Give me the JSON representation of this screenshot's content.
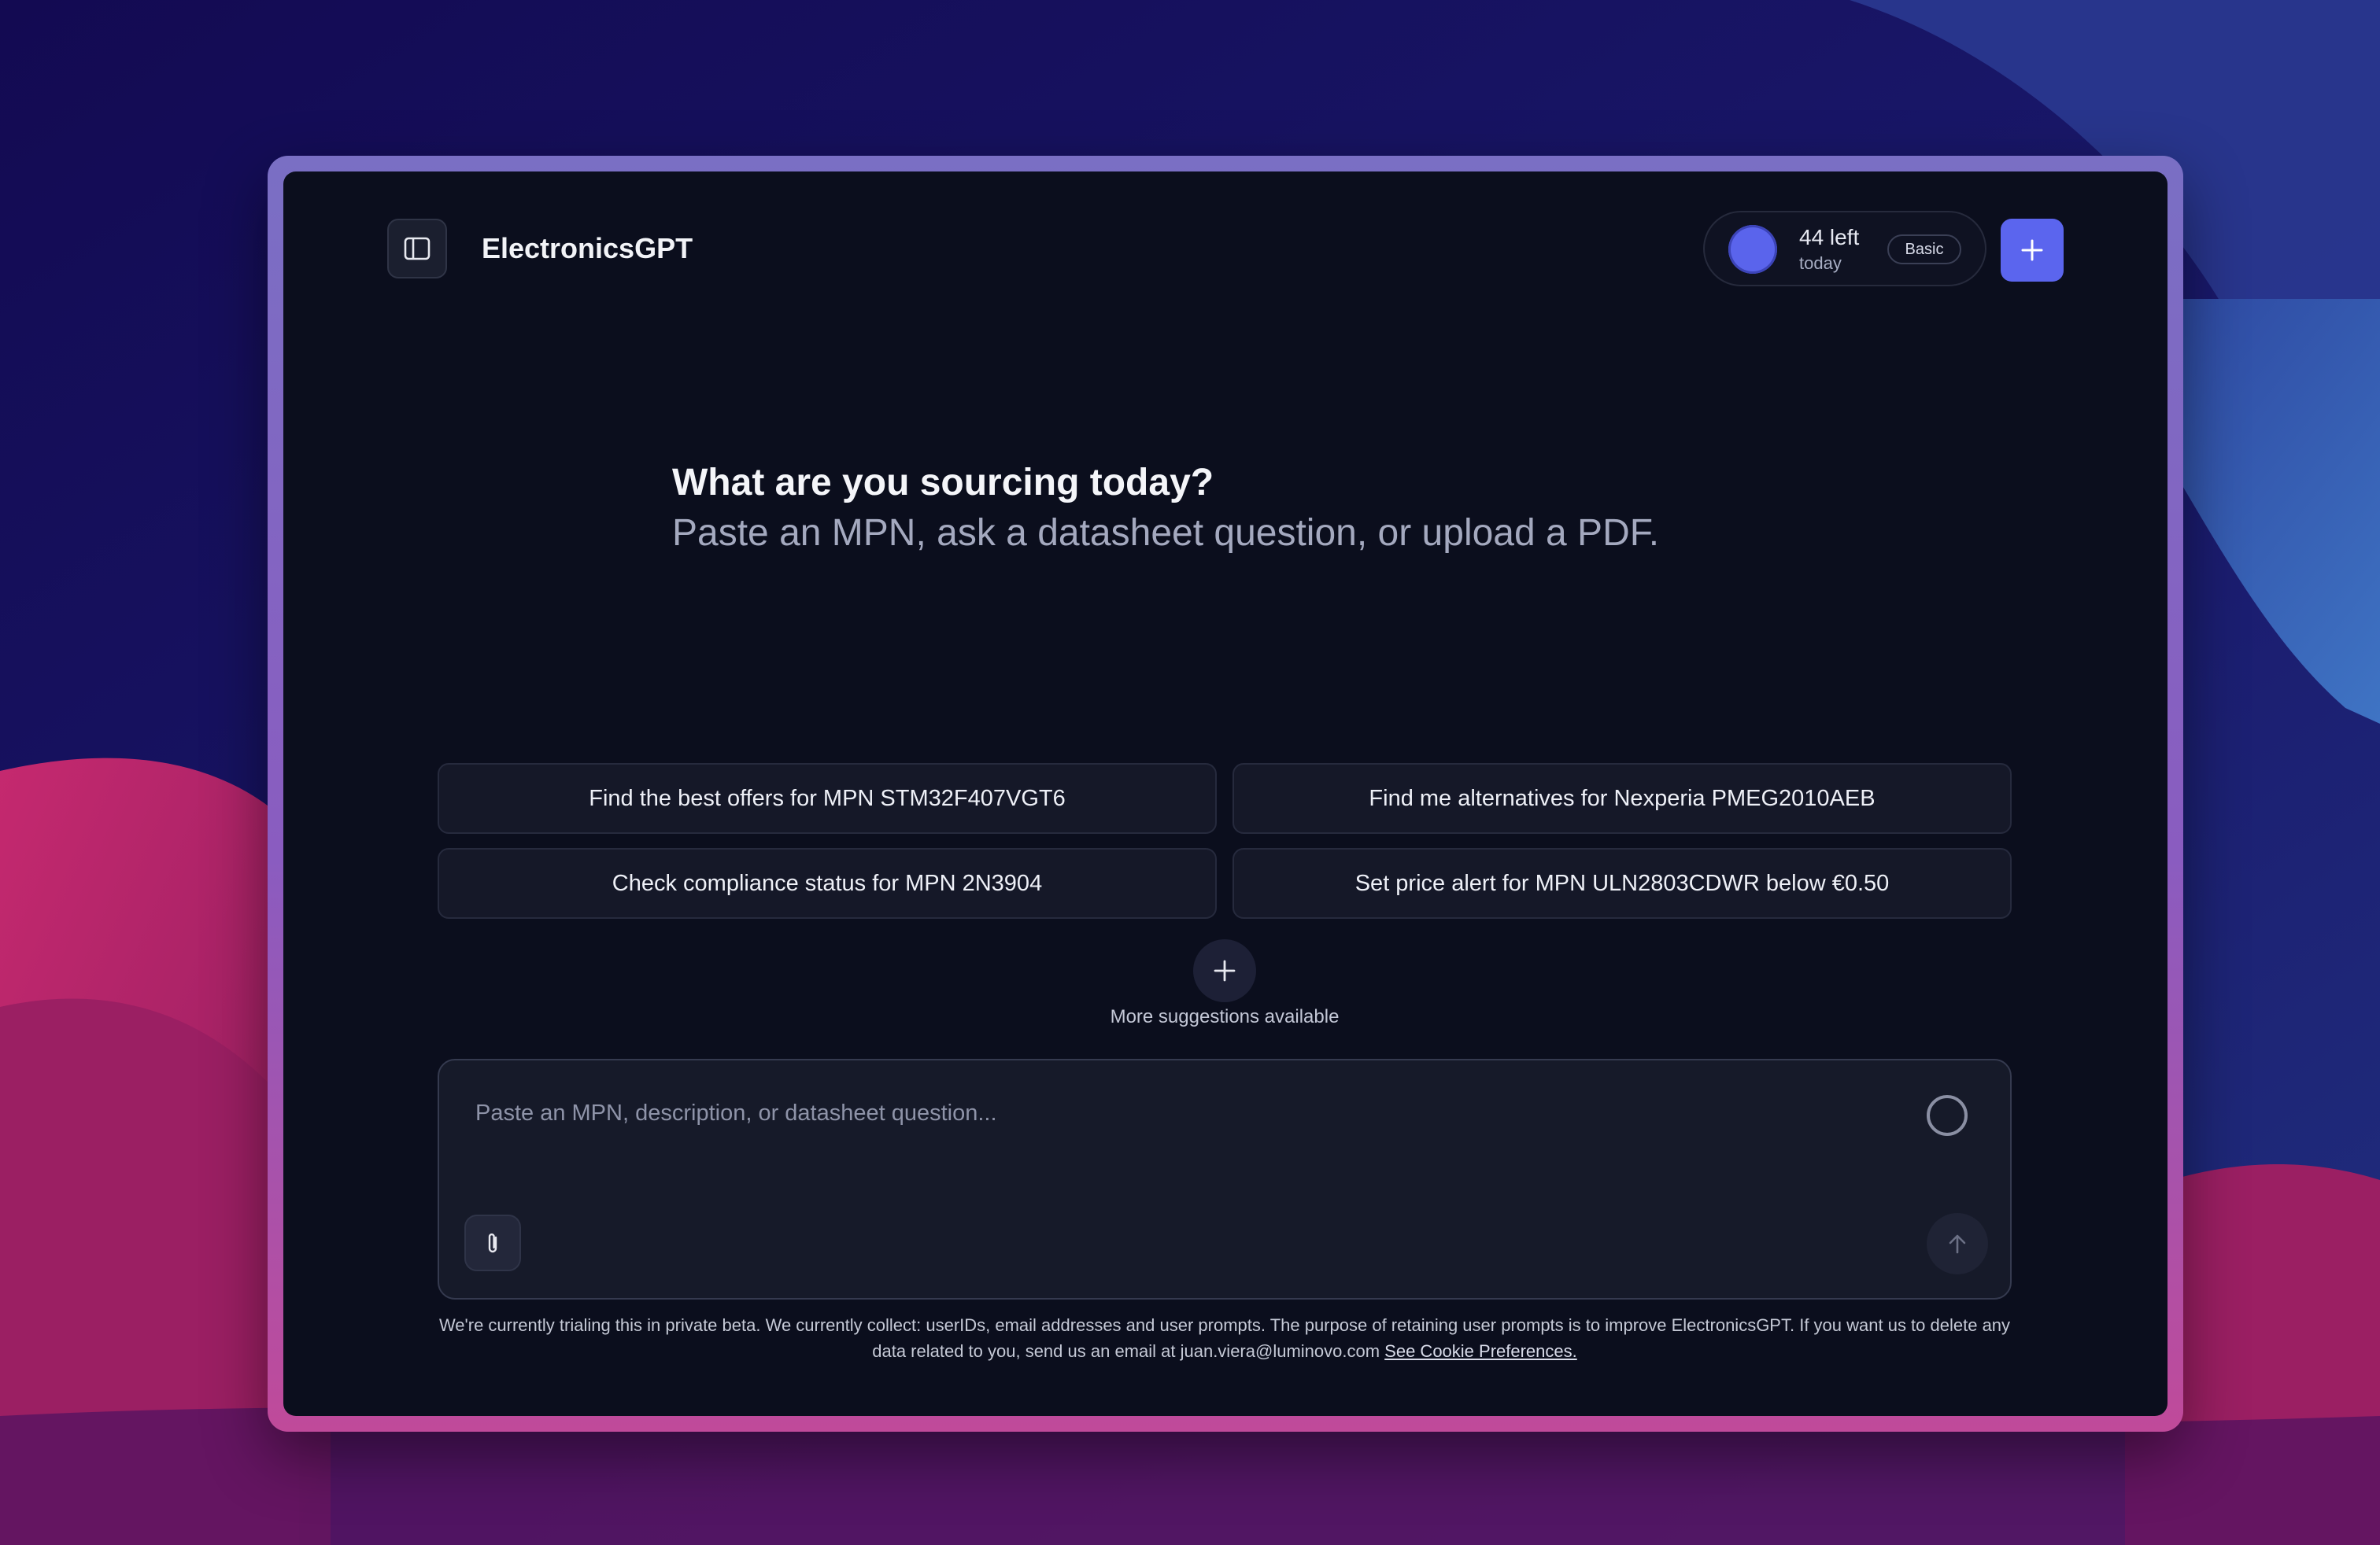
{
  "header": {
    "app_title": "ElectronicsGPT",
    "usage": {
      "count": "44 left",
      "period": "today",
      "plan": "Basic"
    }
  },
  "hero": {
    "title": "What are you sourcing today?",
    "subtitle": "Paste an MPN, ask a datasheet question, or upload a PDF."
  },
  "suggestions": [
    "Find the best offers for MPN STM32F407VGT6",
    "Find me alternatives for Nexperia PMEG2010AEB",
    "Check compliance status for MPN 2N3904",
    "Set price alert for MPN ULN2803CDWR below €0.50"
  ],
  "more_suggestions_label": "More suggestions available",
  "composer": {
    "value": "",
    "placeholder": "Paste an MPN, description, or datasheet question..."
  },
  "footer": {
    "disclaimer": "We're currently trialing this in private beta. We currently collect: userIDs, email addresses and user prompts. The purpose of retaining user prompts is to improve ElectronicsGPT. If you want us to delete any data related to you, send us an email at juan.viera@luminovo.com",
    "cookie_link": "See Cookie Preferences."
  },
  "colors": {
    "accent": "#5b65ee",
    "window_bg": "#0b0e1d",
    "card_bg": "#151828",
    "desktop_pink": "#c0246a",
    "desktop_navy": "#140c55"
  },
  "icons": {
    "sidebar_toggle": "sidebar-panel-icon",
    "new_chat": "plus-icon",
    "more": "plus-icon",
    "attach": "paperclip-icon",
    "send": "arrow-up-icon",
    "status": "circle-outline-icon"
  }
}
